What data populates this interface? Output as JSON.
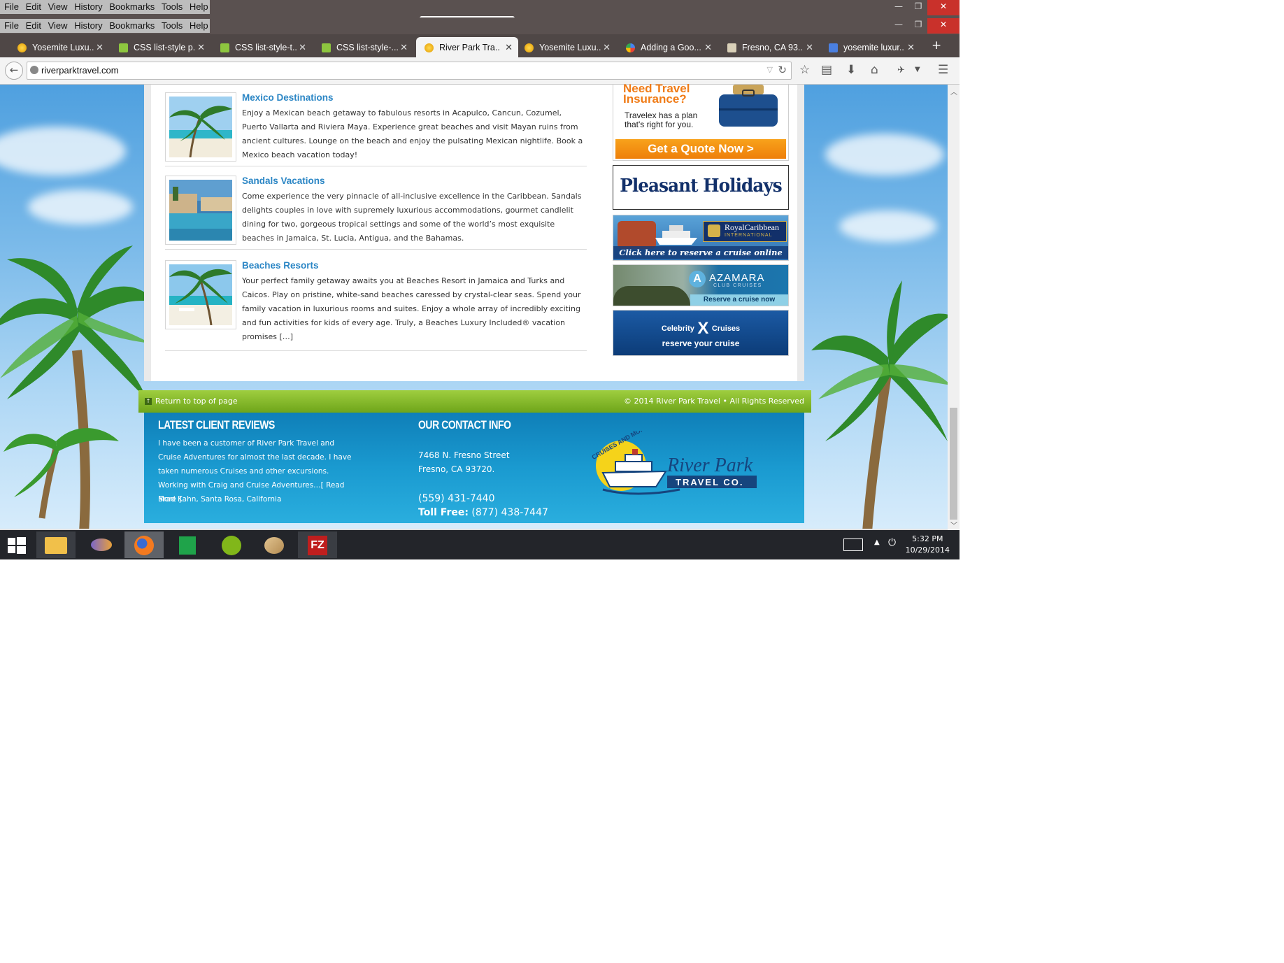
{
  "menubar": [
    "File",
    "Edit",
    "View",
    "History",
    "Bookmarks",
    "Tools",
    "Help"
  ],
  "tabs": [
    {
      "label": "Yosemite Luxu...",
      "icon": "sun-icon",
      "active": false
    },
    {
      "label": "CSS list-style p...",
      "icon": "css-icon",
      "active": false
    },
    {
      "label": "CSS list-style-t...",
      "icon": "css-icon",
      "active": false
    },
    {
      "label": "CSS list-style-...",
      "icon": "css-icon",
      "active": false
    },
    {
      "label": "River Park Tra...",
      "icon": "sun-icon",
      "active": true
    },
    {
      "label": "Yosemite Luxu...",
      "icon": "sun-icon",
      "active": false
    },
    {
      "label": "Adding a Goo...",
      "icon": "google-icon",
      "active": false
    },
    {
      "label": "Fresno, CA 93...",
      "icon": "map-icon",
      "active": false
    },
    {
      "label": "yosemite luxur...",
      "icon": "google-g-icon",
      "active": false
    }
  ],
  "tab_close": "✕",
  "new_tab": "+",
  "url": "riverparktravel.com",
  "posts": [
    {
      "title": "Mexico Destinations",
      "text": "Enjoy a Mexican beach getaway to fabulous resorts in Acapulco, Cancun, Cozumel, Puerto Vallarta and Riviera Maya. Experience great beaches and visit Mayan ruins from ancient cultures. Lounge on the beach and enjoy the pulsating Mexican nightlife. Book a Mexico beach vacation today!"
    },
    {
      "title": "Sandals Vacations",
      "text": "Come experience the very pinnacle of all-inclusive excellence in the Caribbean. Sandals delights couples in love with supremely luxurious accommodations, gourmet candlelit dining for two, gorgeous tropical settings and some of the world’s most exquisite beaches in Jamaica, St. Lucia, Antigua, and the Bahamas."
    },
    {
      "title": "Beaches Resorts",
      "text": "Your perfect family getaway awaits you at Beaches Resort in Jamaica and Turks and Caicos. Play on pristine, white-sand beaches caressed by crystal-clear seas. Spend your family vacation in luxurious rooms and suites. Enjoy a whole array of incredibly exciting and fun activities for kids of every age. Truly, a Beaches Luxury Included® vacation promises […]"
    }
  ],
  "ads": {
    "travelex": {
      "heading": "Need Travel Insurance?",
      "sub": "Travelex has a plan that's right for you.",
      "cta": "Get a Quote Now  >"
    },
    "pleasant": {
      "text": "Pleasant Holidays"
    },
    "royal": {
      "brand": "RoyalCaribbean",
      "brand2": "INTERNATIONAL",
      "cta": "Click here to reserve a cruise online"
    },
    "azamara": {
      "brand": "AZAMARA",
      "sub": "CLUB CRUISES",
      "cta": "Reserve a cruise now"
    },
    "celebrity": {
      "brand_a": "Celebrity",
      "brand_x": "X",
      "brand_b": "Cruises",
      "cta": "reserve your cruise"
    }
  },
  "bar": {
    "return": "Return to top of page",
    "copyright": "© 2014 River Park Travel • All Rights Reserved"
  },
  "footer": {
    "reviews_heading": "LATEST CLIENT REVIEWS",
    "review_text": "I have been a customer of River Park Travel and Cruise Adventures for almost the last decade. I have taken numerous Cruises and other excursions. Working with Craig and Cruise Adventures…",
    "read_more": "[ Read More ]",
    "reviewer": "Brad Kahn, Santa Rosa, California",
    "contact_heading": "OUR CONTACT INFO",
    "address1": "7468 N. Fresno Street",
    "address2": "Fresno,  CA 93720.",
    "phone": "(559) 431-7440",
    "tollfree_label": "Toll Free:",
    "tollfree": "(877) 438-7447",
    "logo_arc": "CRUISES AND MORE",
    "logo_name": "River Park",
    "logo_sub": "TRAVEL CO."
  },
  "clock": {
    "time": "5:32 PM",
    "date": "10/29/2014"
  },
  "colors": {
    "titlebar": "#5a5150",
    "accent_link": "#2b86c5",
    "green_bar": "#7cb327",
    "footer_blue": "#1a9ad0",
    "close_red": "#c9312b"
  }
}
